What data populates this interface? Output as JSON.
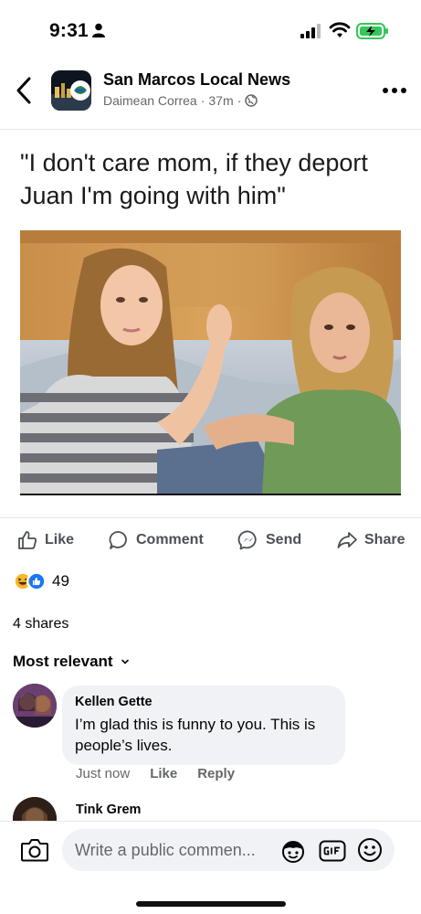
{
  "status_bar": {
    "time": "9:31",
    "icons": [
      "person-icon",
      "signal-icon",
      "wifi-icon",
      "battery-charging-icon"
    ]
  },
  "header": {
    "page_name": "San Marcos Local News",
    "author": "Daimean Correa",
    "separator": "·",
    "time_ago": "37m",
    "icons": [
      "back-arrow-icon",
      "page-logo",
      "globe-icon",
      "more-dots-icon"
    ]
  },
  "post": {
    "meme_caption": "\"I don't care mom, if they deport Juan I'm going with him\""
  },
  "actions": {
    "like": "Like",
    "comment": "Comment",
    "send": "Send",
    "share": "Share"
  },
  "reactions": {
    "count": "49",
    "types": [
      "haha-reaction-icon",
      "like-reaction-icon"
    ]
  },
  "shares": "4 shares",
  "comments_sort": "Most relevant",
  "comments": [
    {
      "author": "Kellen Gette",
      "text": "I’m glad this is funny to you. This is people’s lives.",
      "time": "Just now",
      "like": "Like",
      "reply": "Reply"
    },
    {
      "author": "Tink Grem"
    }
  ],
  "composer": {
    "placeholder": "Write a public commen..."
  },
  "colors": {
    "like_blue": "#1877f2",
    "haha_yellow": "#f7b928",
    "muted_text": "#65676b",
    "bubble_bg": "#f0f2f5"
  }
}
